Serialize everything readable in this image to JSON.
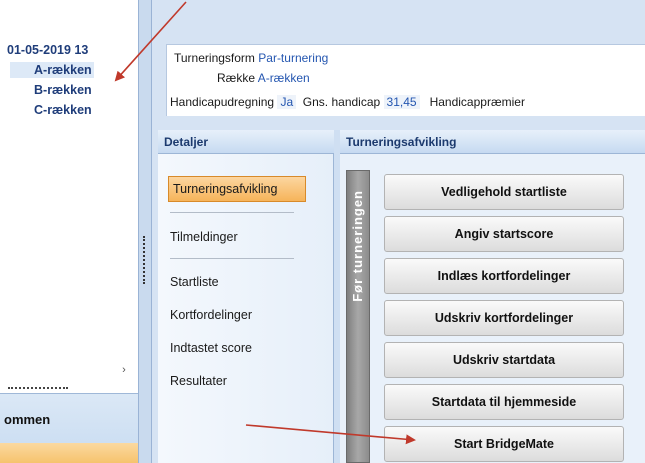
{
  "tree": {
    "date_label": "01-05-2019 13",
    "items": [
      {
        "label": "A-rækken",
        "icon": "people-icon"
      },
      {
        "label": "B-rækken",
        "icon": "people-icon"
      },
      {
        "label": "C-rækken",
        "icon": "people-icon"
      }
    ],
    "selected_index": 0
  },
  "bottom_bar": {
    "label": "ommen"
  },
  "info": {
    "tournament_form_label": "Turneringsform",
    "tournament_form_value": "Par-turnering",
    "row_label": "Række",
    "row_value": "A-rækken",
    "handicap_label": "Handicapudregning",
    "handicap_value": "Ja",
    "avg_handicap_label": "Gns. handicap",
    "avg_handicap_value": "31,45",
    "handicap_prizes_label": "Handicappræmier"
  },
  "details": {
    "header": "Detaljer",
    "nav": [
      {
        "label": "Turneringsafvikling",
        "active": true
      },
      {
        "label": "Tilmeldinger"
      },
      {
        "label": "Startliste"
      },
      {
        "label": "Kortfordelinger"
      },
      {
        "label": "Indtastet score"
      },
      {
        "label": "Resultater"
      }
    ]
  },
  "panel": {
    "header": "Turneringsafvikling",
    "vertical_tab": "Før turneringen",
    "buttons": [
      "Vedligehold startliste",
      "Angiv startscore",
      "Indlæs kortfordelinger",
      "Udskriv kortfordelinger",
      "Udskriv startdata",
      "Startdata til hjemmeside",
      "Start BridgeMate"
    ]
  },
  "colors": {
    "annotation_arrow": "#c0392b",
    "active_nav": "#f6b45a",
    "link_blue": "#2456b0"
  }
}
